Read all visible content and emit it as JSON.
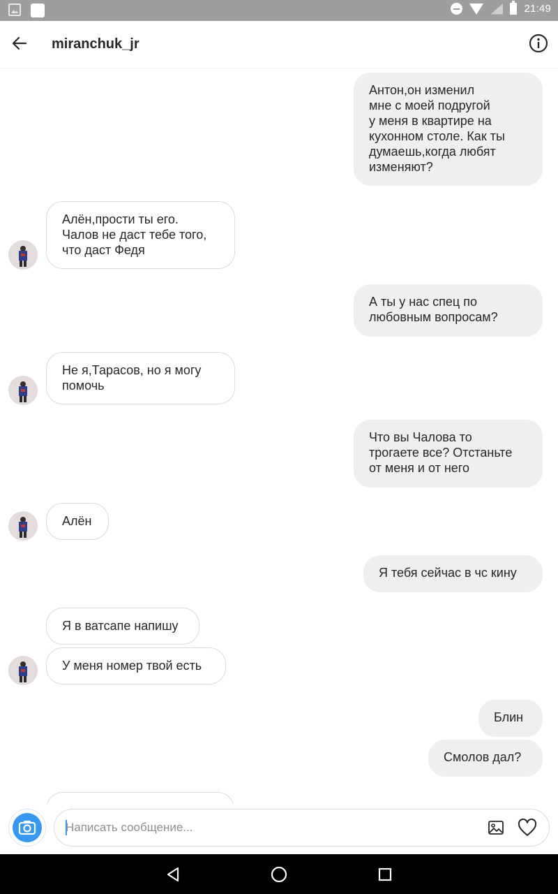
{
  "status_bar": {
    "time": "21:49"
  },
  "header": {
    "title": "miranchuk_jr"
  },
  "messages": [
    {
      "from": "me",
      "text": "Антон,он изменил\nмне с моей подругой\nу меня в квартире на\nкухонном столе. Как ты\nдумаешь,когда любят\nизменяют?"
    },
    {
      "from": "them",
      "text": "Алён,прости ты его.\nЧалов не даст тебе того,\nчто даст Федя"
    },
    {
      "from": "me",
      "text": "А ты у нас спец по\nлюбовным вопросам?"
    },
    {
      "from": "them",
      "text": "Не я,Тарасов, но я могу\nпомочь"
    },
    {
      "from": "me",
      "text": "Что вы Чалова то\nтрогаете все? Отстаньте\nот меня и от него"
    },
    {
      "from": "them",
      "text": "Алён"
    },
    {
      "from": "me",
      "text": "Я тебя сейчас в чс кину"
    },
    {
      "from": "them",
      "text": "Я в ватсапе напишу"
    },
    {
      "from": "them",
      "text": "У меня номер твой есть"
    },
    {
      "from": "me",
      "text": "Блин"
    },
    {
      "from": "me",
      "text": "Смолов дал?"
    }
  ],
  "composer": {
    "placeholder": "Написать сообщение..."
  },
  "icons": {
    "back": "arrow-left-icon",
    "info": "info-icon",
    "camera": "camera-icon",
    "gallery": "image-icon",
    "heart": "heart-icon",
    "nav_back": "triangle-back-icon",
    "nav_home": "circle-home-icon",
    "nav_recents": "square-recents-icon"
  },
  "colors": {
    "my_bubble": "#efefef",
    "their_border": "#dbdbdb",
    "camera_blue": "#3897f0",
    "status_bar": "#9e9e9e"
  }
}
